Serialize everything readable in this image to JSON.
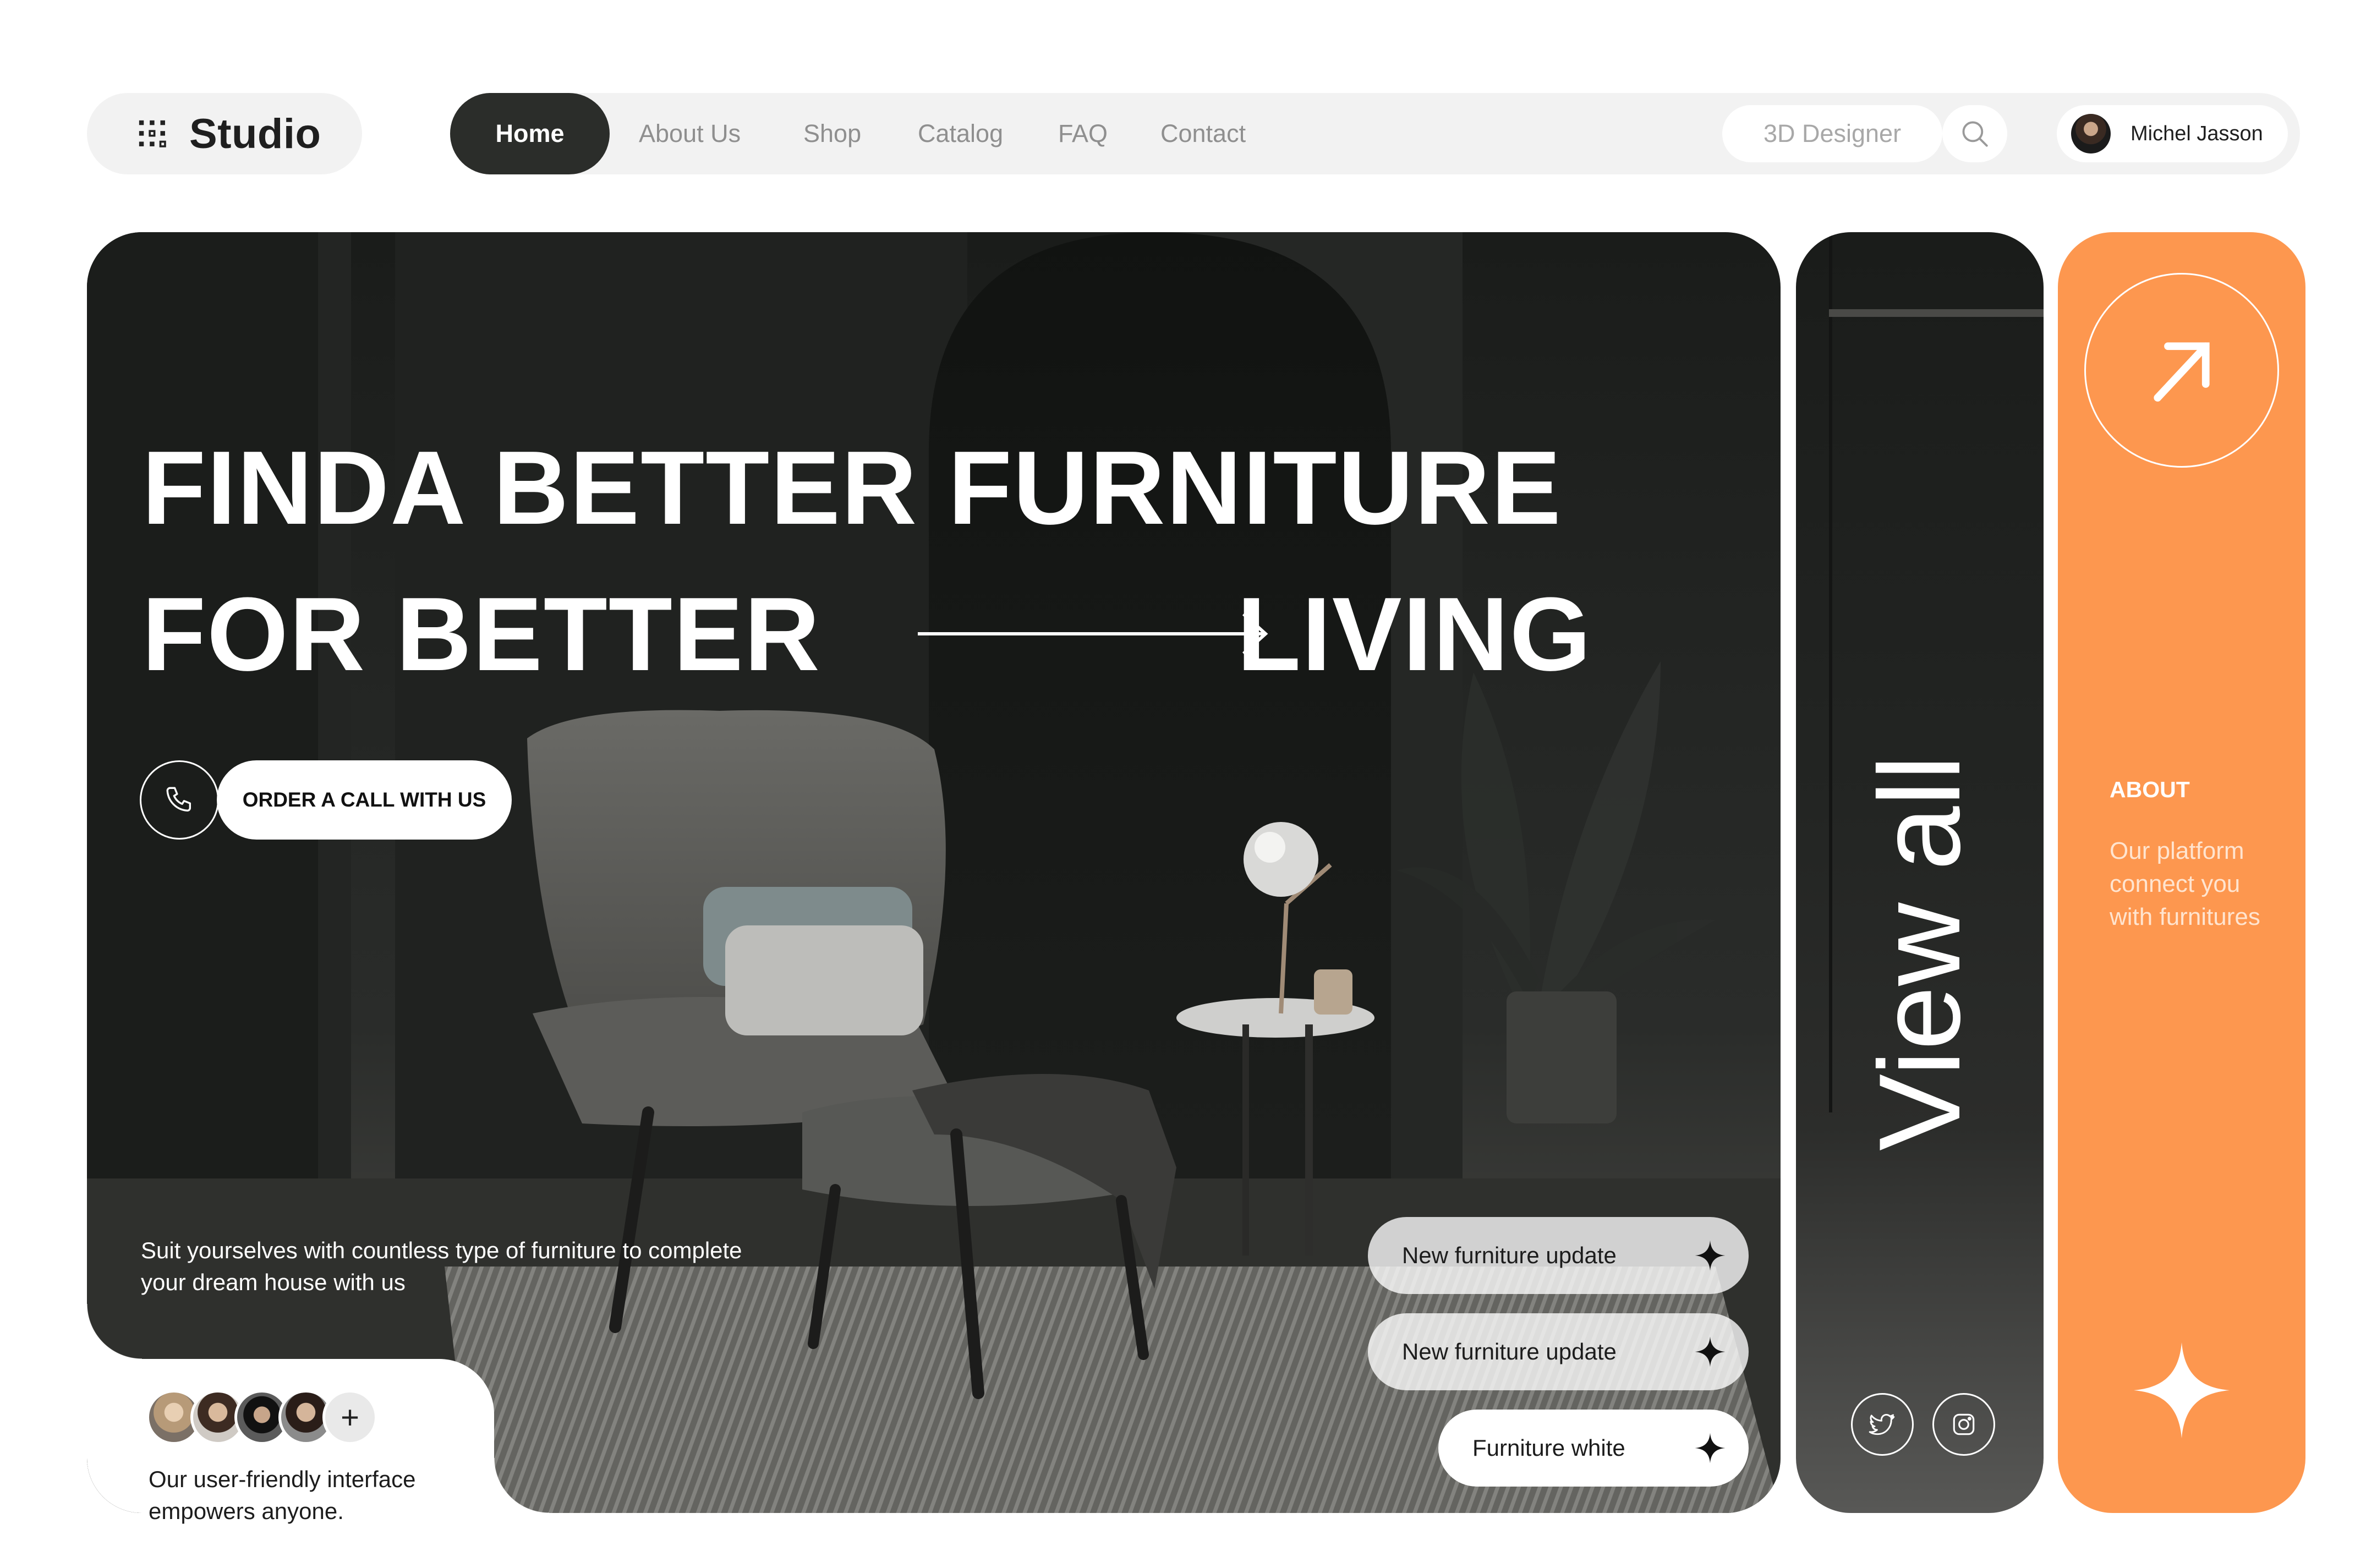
{
  "header": {
    "brand": "Studio",
    "nav": [
      "Home",
      "About Us",
      "Shop",
      "Catalog",
      "FAQ",
      "Contact"
    ],
    "active_nav": "Home",
    "designer_label": "3D Designer",
    "user_name": "Michel Jasson"
  },
  "hero": {
    "title_line1": "FINDA BETTER FURNITURE",
    "title_line2_left": "FOR BETTER",
    "title_line2_right": "LIVING",
    "cta_label": "ORDER A CALL WITH US",
    "description": "Suit yourselves with countless type of furniture to complete your dream house with us",
    "tags": [
      "New furniture update",
      "New furniture update",
      "Furniture white"
    ]
  },
  "community": {
    "text": "Our user-friendly interface empowers anyone.",
    "add_symbol": "+"
  },
  "view_all": {
    "label": "View all"
  },
  "about": {
    "title": "ABOUT",
    "description": "Our platform connect you with furnitures"
  },
  "colors": {
    "accent": "#fd974f",
    "dark": "#2b2d2a",
    "pill_bg": "#f2f2f2"
  },
  "icons": [
    "grid-logo-icon",
    "search-icon",
    "phone-icon",
    "arrow-right-icon",
    "sparkle-icon",
    "twitter-icon",
    "instagram-icon",
    "arrow-up-right-icon"
  ]
}
